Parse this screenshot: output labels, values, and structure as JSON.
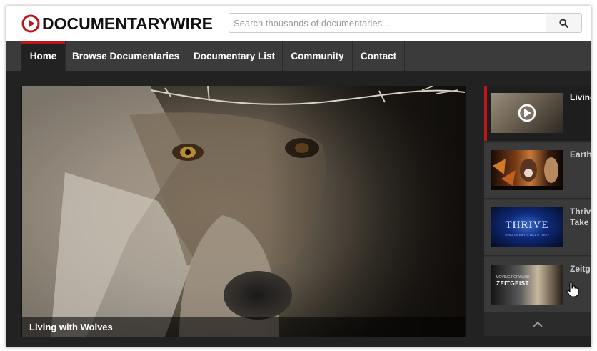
{
  "logo": {
    "text": "DOCUMENTARYWIRE",
    "icon": "play-circle-icon",
    "accent": "#c0161b"
  },
  "search": {
    "placeholder": "Search thousands of documentaries...",
    "value": "",
    "button_icon": "search-icon"
  },
  "nav": {
    "items": [
      {
        "label": "Home",
        "active": true
      },
      {
        "label": "Browse Documentaries",
        "active": false
      },
      {
        "label": "Documentary List",
        "active": false
      },
      {
        "label": "Community",
        "active": false
      },
      {
        "label": "Contact",
        "active": false
      }
    ]
  },
  "featured": {
    "caption": "Living with Wolves"
  },
  "sidebar": {
    "items": [
      {
        "title": "Living",
        "active": true,
        "icon": "play-icon"
      },
      {
        "title": "Earth",
        "active": false
      },
      {
        "title": "Thrive\nTake",
        "thumb_text": "THRIVE",
        "thumb_subtext": "WHAT ON EARTH WILL IT TAKE?",
        "active": false
      },
      {
        "title": "Zeitge",
        "thumb_text": "ZEITGEIST",
        "thumb_subtext": "MOVING FORWARD",
        "active": false
      }
    ],
    "scroll_icon": "chevron-up-icon"
  },
  "colors": {
    "nav_bg": "#3b3b3b",
    "page_bg": "#222222",
    "accent": "#c0161b"
  }
}
